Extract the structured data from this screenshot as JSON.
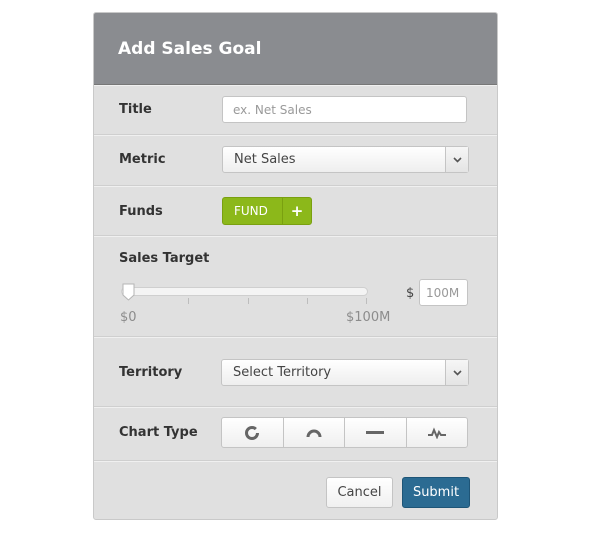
{
  "dialog": {
    "title": "Add Sales Goal"
  },
  "title_field": {
    "label": "Title",
    "placeholder": "ex. Net Sales"
  },
  "metric_field": {
    "label": "Metric",
    "selected": "Net Sales"
  },
  "funds_field": {
    "label": "Funds",
    "button_label": "FUND",
    "add_glyph": "+"
  },
  "sales_target": {
    "label": "Sales Target",
    "min_label": "$0",
    "max_label": "$100M",
    "currency_symbol": "$",
    "input_placeholder": "100M",
    "value_fraction": 0
  },
  "territory_field": {
    "label": "Territory",
    "selected": "Select Territory"
  },
  "chart_type": {
    "label": "Chart Type",
    "options": [
      "donut-chart-icon",
      "arc-chart-icon",
      "bar-line-icon",
      "sparkline-icon"
    ]
  },
  "actions": {
    "cancel_label": "Cancel",
    "submit_label": "Submit"
  },
  "colors": {
    "header": "#8a8c90",
    "fund": "#8cb81a",
    "submit": "#2b6b92",
    "panel": "#e0e0e0"
  }
}
